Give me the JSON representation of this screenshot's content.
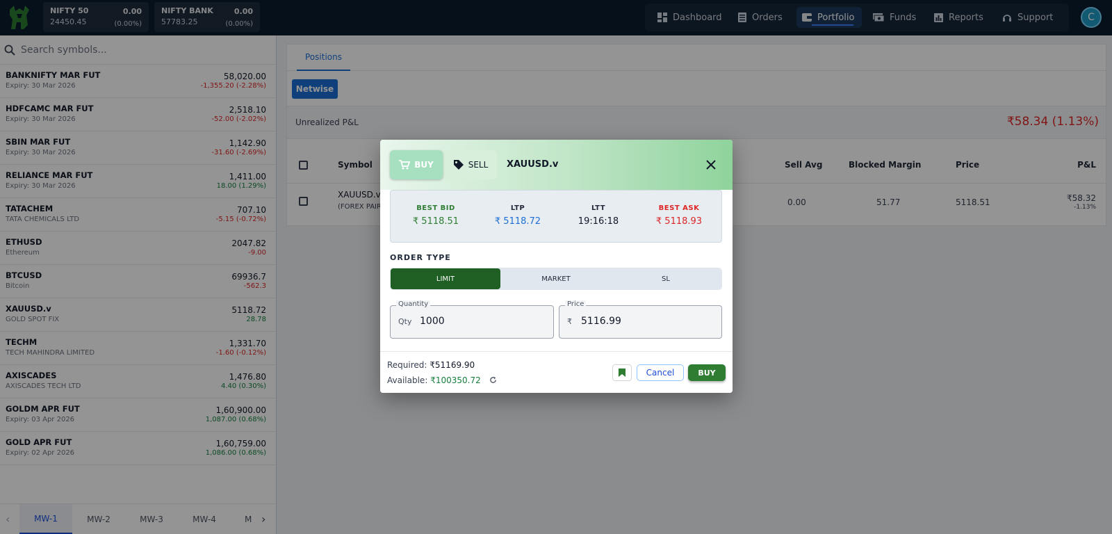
{
  "topbar": {
    "indices": [
      {
        "name": "NIFTY 50",
        "value": "24450.45",
        "change": "0.00",
        "pct": "(0.00%)"
      },
      {
        "name": "NIFTY BANK",
        "value": "57783.25",
        "change": "0.00",
        "pct": "(0.00%)"
      }
    ],
    "nav": [
      {
        "label": "Dashboard",
        "icon": "dashboard-icon"
      },
      {
        "label": "Orders",
        "icon": "orders-icon"
      },
      {
        "label": "Portfolio",
        "icon": "portfolio-icon",
        "active": true
      },
      {
        "label": "Funds",
        "icon": "funds-icon"
      },
      {
        "label": "Reports",
        "icon": "reports-icon"
      },
      {
        "label": "Support",
        "icon": "support-icon"
      }
    ],
    "avatar_initial": "C"
  },
  "sidebar": {
    "search_placeholder": "Search symbols...",
    "items": [
      {
        "symbol": "BANKNIFTY MAR FUT",
        "sub": "Expiry: 30 Mar 2026",
        "price": "58,020.00",
        "change": "-1,355.20 (-2.28%)",
        "dir": "neg"
      },
      {
        "symbol": "HDFCAMC MAR FUT",
        "sub": "Expiry: 30 Mar 2026",
        "price": "2,518.10",
        "change": "-52.00 (-2.02%)",
        "dir": "neg"
      },
      {
        "symbol": "SBIN MAR FUT",
        "sub": "Expiry: 30 Mar 2026",
        "price": "1,142.90",
        "change": "-31.60 (-2.69%)",
        "dir": "neg"
      },
      {
        "symbol": "RELIANCE MAR FUT",
        "sub": "Expiry: 30 Mar 2026",
        "price": "1,411.00",
        "change": "18.00 (1.29%)",
        "dir": "pos"
      },
      {
        "symbol": "TATACHEM",
        "sub": "TATA CHEMICALS LTD",
        "price": "707.10",
        "change": "-5.15 (-0.72%)",
        "dir": "neg"
      },
      {
        "symbol": "ETHUSD",
        "sub": "Ethereum",
        "price": "2047.82",
        "change": "-9.00",
        "dir": "neg"
      },
      {
        "symbol": "BTCUSD",
        "sub": "Bitcoin",
        "price": "69936.7",
        "change": "-562.3",
        "dir": "neg"
      },
      {
        "symbol": "XAUUSD.v",
        "sub": "GOLD SPOT FIX",
        "price": "5118.72",
        "change": "28.78",
        "dir": "pos"
      },
      {
        "symbol": "TECHM",
        "sub": "TECH MAHINDRA LIMITED",
        "price": "1,331.70",
        "change": "-1.60 (-0.12%)",
        "dir": "neg"
      },
      {
        "symbol": "AXISCADES",
        "sub": "AXISCADES TECH LTD",
        "price": "1,476.80",
        "change": "4.40 (0.30%)",
        "dir": "pos"
      },
      {
        "symbol": "GOLDM APR FUT",
        "sub": "Expiry: 03 Apr 2026",
        "price": "1,60,900.00",
        "change": "1,087.00 (0.68%)",
        "dir": "pos"
      },
      {
        "symbol": "GOLD APR FUT",
        "sub": "Expiry: 02 Apr 2026",
        "price": "1,60,759.00",
        "change": "1,086.00 (0.68%)",
        "dir": "pos"
      }
    ],
    "mw_tabs": [
      "MW-1",
      "MW-2",
      "MW-3",
      "MW-4",
      "M"
    ]
  },
  "main": {
    "tab": "Positions",
    "netwise_label": "Netwise",
    "pnl_label": "Unrealized P&L",
    "pnl_value": "₹58.34 (1.13%)",
    "columns": {
      "symbol": "Symbol",
      "sell_avg": "Sell Avg",
      "blocked_margin": "Blocked Margin",
      "price": "Price",
      "pnl": "P&L"
    },
    "row": {
      "symbol": "XAUUSD.v",
      "type": "(FOREX PAIR)",
      "sell_avg": "0.00",
      "blocked_margin": "51.77",
      "price": "5118.51",
      "pnl": "₹58.32",
      "pnl_pct": "-1.13%"
    }
  },
  "modal": {
    "buy_label": "BUY",
    "sell_label": "SELL",
    "symbol": "XAUUSD.v",
    "quote": {
      "best_bid_label": "BEST BID",
      "best_bid": "₹ 5118.51",
      "ltp_label": "LTP",
      "ltp": "₹ 5118.72",
      "ltt_label": "LTT",
      "ltt": "19:16:18",
      "best_ask_label": "BEST ASK",
      "best_ask": "₹ 5118.93"
    },
    "order_type_label": "ORDER TYPE",
    "order_types": [
      "LIMIT",
      "MARKET",
      "SL"
    ],
    "quantity_label": "Quantity",
    "quantity_prefix": "Qty",
    "quantity": "1000",
    "price_label": "Price",
    "price_prefix": "₹",
    "price": "5116.99",
    "required_label": "Required:",
    "required": "₹51169.90",
    "available_label": "Available:",
    "available": "₹100350.72",
    "cancel_label": "Cancel",
    "submit_label": "BUY"
  },
  "colors": {
    "accent_green": "#2e7d32",
    "negative": "#dc2626",
    "positive": "#15803d",
    "link_blue": "#1d6fd6"
  }
}
